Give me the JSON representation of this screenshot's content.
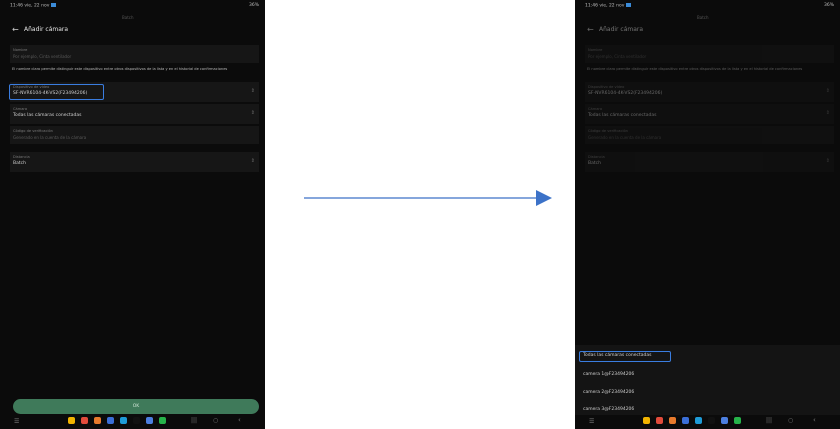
{
  "status": {
    "time_date": "11:46 vie, 22 nov",
    "battery": "36%",
    "top_label": "Batch"
  },
  "appbar": {
    "title": "Añadir cámara"
  },
  "form": {
    "nombre_label": "Nombre",
    "nombre_placeholder": "Por ejemplo, Cinta ventilador",
    "hint": "El nombre claro permite distinguir este dispositivo entre otros dispositivos de la lista y en el historial de confirmaciones",
    "device_label": "Dispositivo de vídeo",
    "device_value": "SF-NVR6104-4K-VS2(F23494206)",
    "camera_label": "Cámara",
    "camera_value": "Todas las cámaras conectadas",
    "code_label": "Código de verificación",
    "code_placeholder": "Generado en la cuenta de la cámara",
    "distance_label": "Distancia",
    "distance_value": "Batch"
  },
  "ok_label": "OK",
  "dropdown": {
    "options": [
      "Todas las cámaras conectadas",
      "camera 1@F23494206",
      "camera 2@F23494206",
      "camera 3@F23494206"
    ]
  },
  "colors": {
    "highlight": "#3a7de0",
    "ok_button": "#3f7a5a",
    "arrow": "#3c72c8"
  },
  "icons": [
    "back-arrow-icon",
    "chevron-updown-icon",
    "menu-icon",
    "recent-apps-icon",
    "home-icon",
    "nav-back-icon"
  ]
}
